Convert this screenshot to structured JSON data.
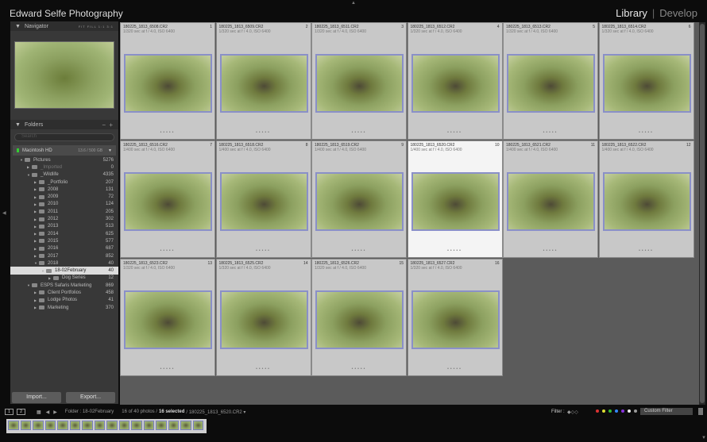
{
  "header": {
    "brand": "Edward Selfe Photography",
    "modules": [
      {
        "label": "Library",
        "active": true
      },
      {
        "label": "Develop",
        "active": false
      }
    ]
  },
  "navigator": {
    "title": "Navigator",
    "zoom_options": "FIT FILL 1:1 3:1"
  },
  "folders": {
    "title": "Folders",
    "search_placeholder": "Search",
    "volume": {
      "name": "Macintosh HD",
      "space": "13.6 / 500 GB"
    },
    "items": [
      {
        "label": "Pictures",
        "count": "5276",
        "depth": 0,
        "exp": "▼"
      },
      {
        "label": "_Imported",
        "count": "0",
        "depth": 1,
        "exp": "▶",
        "dim": true
      },
      {
        "label": "_Wildlife",
        "count": "4335",
        "depth": 1,
        "exp": "▼"
      },
      {
        "label": "_Portfolio",
        "count": "207",
        "depth": 2,
        "exp": "▶"
      },
      {
        "label": "2008",
        "count": "131",
        "depth": 2,
        "exp": "▶"
      },
      {
        "label": "2009",
        "count": "72",
        "depth": 2,
        "exp": "▶"
      },
      {
        "label": "2010",
        "count": "124",
        "depth": 2,
        "exp": "▶"
      },
      {
        "label": "2011",
        "count": "205",
        "depth": 2,
        "exp": "▶"
      },
      {
        "label": "2012",
        "count": "302",
        "depth": 2,
        "exp": "▶"
      },
      {
        "label": "2013",
        "count": "513",
        "depth": 2,
        "exp": "▶"
      },
      {
        "label": "2014",
        "count": "625",
        "depth": 2,
        "exp": "▶"
      },
      {
        "label": "2015",
        "count": "577",
        "depth": 2,
        "exp": "▶"
      },
      {
        "label": "2016",
        "count": "687",
        "depth": 2,
        "exp": "▶"
      },
      {
        "label": "2017",
        "count": "852",
        "depth": 2,
        "exp": "▶"
      },
      {
        "label": "2018",
        "count": "40",
        "depth": 2,
        "exp": "▼"
      },
      {
        "label": "18-02February",
        "count": "40",
        "depth": 3,
        "exp": "▼",
        "selected": true
      },
      {
        "label": "Dog Series",
        "count": "12",
        "depth": 4,
        "exp": "▶"
      },
      {
        "label": "ESPS Safaris Marketing",
        "count": "869",
        "depth": 1,
        "exp": "▼"
      },
      {
        "label": "Client Portfolios",
        "count": "458",
        "depth": 2,
        "exp": "▶"
      },
      {
        "label": "Lodge Photos",
        "count": "41",
        "depth": 2,
        "exp": "▶"
      },
      {
        "label": "Marketing",
        "count": "370",
        "depth": 2,
        "exp": "▶"
      }
    ]
  },
  "buttons": {
    "import": "Import...",
    "export": "Export..."
  },
  "grid": [
    {
      "n": "1",
      "file": "180225_1813_6508.CR2",
      "exif": "1/320 sec at f / 4.0, ISO 6400"
    },
    {
      "n": "2",
      "file": "180225_1813_6509.CR2",
      "exif": "1/320 sec at f / 4.0, ISO 6400"
    },
    {
      "n": "3",
      "file": "180225_1813_6511.CR2",
      "exif": "1/320 sec at f / 4.0, ISO 6400"
    },
    {
      "n": "4",
      "file": "180225_1813_6512.CR2",
      "exif": "1/320 sec at f / 4.0, ISO 6400"
    },
    {
      "n": "5",
      "file": "180225_1813_6513.CR2",
      "exif": "1/320 sec at f / 4.0, ISO 6400"
    },
    {
      "n": "6",
      "file": "180225_1813_6514.CR2",
      "exif": "1/320 sec at f / 4.0, ISO 6400"
    },
    {
      "n": "7",
      "file": "180225_1813_6516.CR2",
      "exif": "1/400 sec at f / 4.0, ISO 6400"
    },
    {
      "n": "8",
      "file": "180225_1813_6518.CR2",
      "exif": "1/400 sec at f / 4.0, ISO 6400"
    },
    {
      "n": "9",
      "file": "180225_1813_6519.CR2",
      "exif": "1/400 sec at f / 4.0, ISO 6400"
    },
    {
      "n": "10",
      "file": "180225_1813_6520.CR2",
      "exif": "1/400 sec at f / 4.0, ISO 6400",
      "focus": true
    },
    {
      "n": "11",
      "file": "180225_1813_6521.CR2",
      "exif": "1/400 sec at f / 4.0, ISO 6400"
    },
    {
      "n": "12",
      "file": "180225_1813_6522.CR2",
      "exif": "1/400 sec at f / 4.0, ISO 6400"
    },
    {
      "n": "13",
      "file": "180225_1813_6523.CR2",
      "exif": "1/320 sec at f / 4.0, ISO 6400"
    },
    {
      "n": "14",
      "file": "180225_1813_6525.CR2",
      "exif": "1/320 sec at f / 4.0, ISO 6400"
    },
    {
      "n": "15",
      "file": "180225_1813_6526.CR2",
      "exif": "1/320 sec at f / 4.0, ISO 6400"
    },
    {
      "n": "16",
      "file": "180225_1813_6527.CR2",
      "exif": "1/320 sec at f / 4.0, ISO 6400"
    }
  ],
  "toolbar": {
    "view1": "1",
    "view2": "2",
    "folder": "Folder : 18-02February",
    "count": "16 of 40 photos /",
    "selected": "16 selected",
    "file": "/ 180225_1813_6520.CR2 ▾",
    "filter_label": "Filter :",
    "filter_preset": "Custom Filter",
    "label_colors": [
      "#d33",
      "#dd3",
      "#3b3",
      "#38f",
      "#83d",
      "#eee",
      "#999"
    ]
  }
}
